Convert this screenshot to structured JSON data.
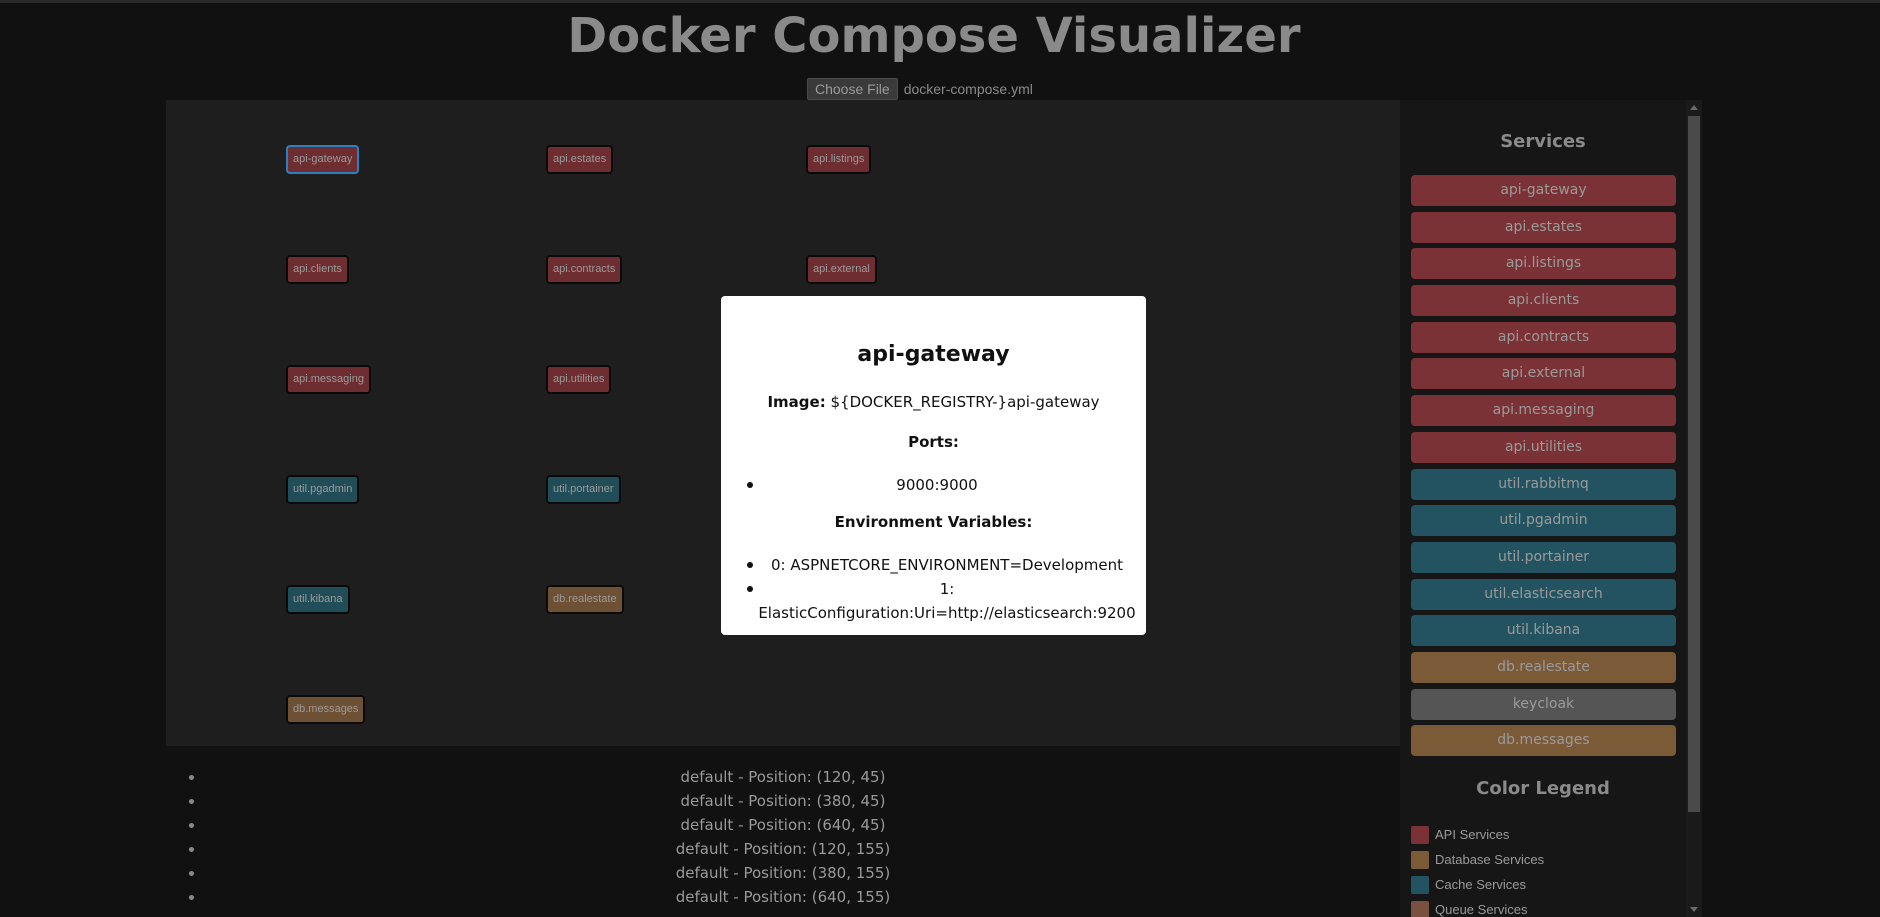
{
  "page": {
    "title": "Docker Compose Visualizer"
  },
  "file_input": {
    "button_label": "Choose File",
    "file_name": "docker-compose.yml"
  },
  "graph": {
    "nodes": [
      {
        "label": "api-gateway",
        "category": "api",
        "selected": true
      },
      {
        "label": "api.estates",
        "category": "api"
      },
      {
        "label": "api.listings",
        "category": "api"
      },
      {
        "label": "api.clients",
        "category": "api"
      },
      {
        "label": "api.contracts",
        "category": "api"
      },
      {
        "label": "api.external",
        "category": "api"
      },
      {
        "label": "api.messaging",
        "category": "api"
      },
      {
        "label": "api.utilities",
        "category": "api"
      },
      {
        "label": "util.pgadmin",
        "category": "cache"
      },
      {
        "label": "util.portainer",
        "category": "cache"
      },
      {
        "label": "util.kibana",
        "category": "cache"
      },
      {
        "label": "db.realestate",
        "category": "db"
      },
      {
        "label": "db.messages",
        "category": "db"
      }
    ]
  },
  "modal": {
    "title": "api-gateway",
    "image_label": "Image:",
    "image_value": "${DOCKER_REGISTRY-}api-gateway",
    "ports_heading": "Ports:",
    "ports": [
      "9000:9000"
    ],
    "env_heading": "Environment Variables:",
    "env": [
      "0: ASPNETCORE_ENVIRONMENT=Development",
      "1: ElasticConfiguration:Uri=http://elasticsearch:9200"
    ]
  },
  "positions": [
    "default - Position: (120, 45)",
    "default - Position: (380, 45)",
    "default - Position: (640, 45)",
    "default - Position: (120, 155)",
    "default - Position: (380, 155)",
    "default - Position: (640, 155)"
  ],
  "sidebar": {
    "title": "Services",
    "services": [
      {
        "label": "api-gateway",
        "category": "api"
      },
      {
        "label": "api.estates",
        "category": "api"
      },
      {
        "label": "api.listings",
        "category": "api"
      },
      {
        "label": "api.clients",
        "category": "api"
      },
      {
        "label": "api.contracts",
        "category": "api"
      },
      {
        "label": "api.external",
        "category": "api"
      },
      {
        "label": "api.messaging",
        "category": "api"
      },
      {
        "label": "api.utilities",
        "category": "api"
      },
      {
        "label": "util.rabbitmq",
        "category": "cache"
      },
      {
        "label": "util.pgadmin",
        "category": "cache"
      },
      {
        "label": "util.portainer",
        "category": "cache"
      },
      {
        "label": "util.elasticsearch",
        "category": "cache"
      },
      {
        "label": "util.kibana",
        "category": "cache"
      },
      {
        "label": "db.realestate",
        "category": "db"
      },
      {
        "label": "keycloak",
        "category": "auth"
      },
      {
        "label": "db.messages",
        "category": "db"
      }
    ],
    "legend_title": "Color Legend",
    "legend": [
      {
        "label": "API Services",
        "color": "#7b3236"
      },
      {
        "label": "Database Services",
        "color": "#7b5a38"
      },
      {
        "label": "Cache Services",
        "color": "#235360"
      },
      {
        "label": "Queue Services",
        "color": "#7a5040"
      }
    ]
  },
  "colors": {
    "api": "#7b3236",
    "cache": "#235360",
    "db": "#7b5a38",
    "auth": "#555555",
    "selected_border": "#2d7fc0"
  }
}
